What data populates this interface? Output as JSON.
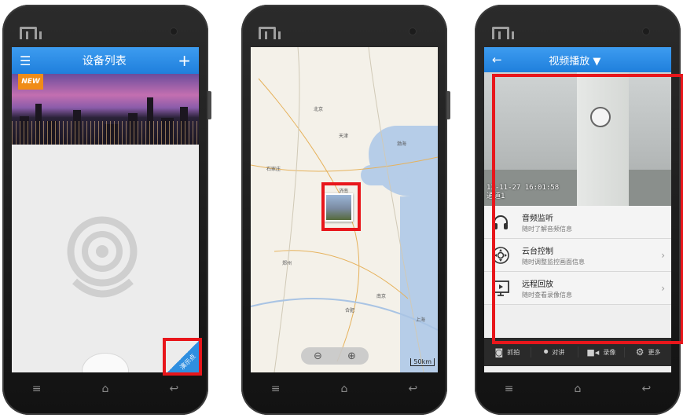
{
  "phone1": {
    "header_title": "设备列表",
    "menu_icon": "hamburger-icon",
    "add_icon": "plus-icon",
    "banner_badge": "NEW",
    "demo_corner_label": "演示点"
  },
  "phone2": {
    "zoom_out_icon": "zoom-out-icon",
    "zoom_in_icon": "zoom-in-icon",
    "scale_label": "50km",
    "cities": [
      "北京",
      "天津",
      "石家庄",
      "渤海",
      "济南",
      "郑州",
      "合肥",
      "南京",
      "上海"
    ]
  },
  "phone3": {
    "header_title": "视频播放",
    "video_osd_time": "13-11-27 16:01:58",
    "video_osd_channel": "通道1",
    "list": [
      {
        "title": "音频监听",
        "subtitle": "随时了解音频信息",
        "icon": "headphones-icon",
        "has_chevron": false
      },
      {
        "title": "云台控制",
        "subtitle": "随时调整监控画面信息",
        "icon": "ptz-control-icon",
        "has_chevron": true
      },
      {
        "title": "远程回放",
        "subtitle": "随时查看录像信息",
        "icon": "playback-icon",
        "has_chevron": true
      }
    ],
    "toolbar": {
      "capture": "抓拍",
      "talk": "对讲",
      "record": "录像",
      "more": "更多"
    }
  },
  "colors": {
    "header_blue": "#2a8ae6",
    "highlight_red": "#e8161b",
    "phone_body": "#1c1c1c"
  }
}
